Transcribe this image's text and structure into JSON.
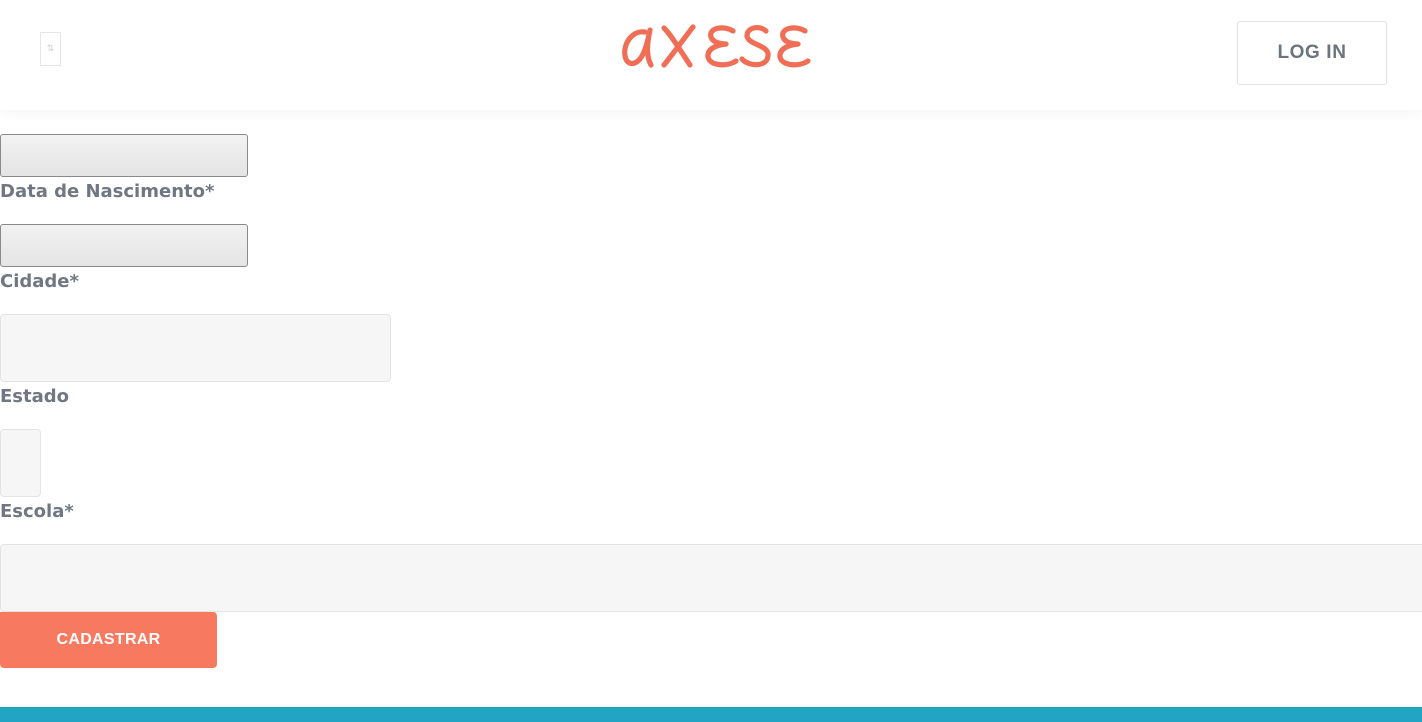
{
  "header": {
    "logo_text": "AXESE",
    "login_label": "LOG IN",
    "menu_icon": "menu-icon"
  },
  "form": {
    "fields": [
      {
        "type": "date",
        "value": ""
      },
      {
        "label": "Data de Nascimento*",
        "type": "date",
        "value": ""
      },
      {
        "label": "Cidade*",
        "type": "text",
        "value": ""
      },
      {
        "label": "Estado",
        "type": "select",
        "value": ""
      },
      {
        "label": "Escola*",
        "type": "text",
        "value": ""
      }
    ],
    "submit_label": "CADASTRAR"
  },
  "colors": {
    "brand": "#f06e56",
    "submit_button": "#f77a60",
    "footer": "#22a5c3",
    "label_text": "#6f7782"
  }
}
